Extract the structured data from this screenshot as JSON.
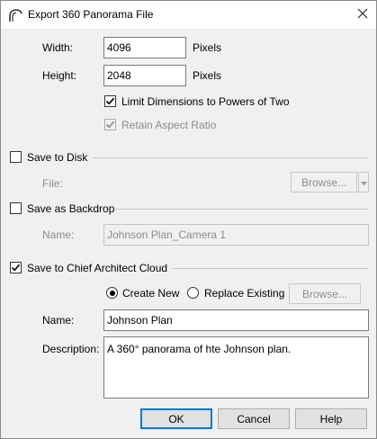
{
  "window": {
    "title": "Export 360 Panorama File"
  },
  "size": {
    "width_label": "Width:",
    "width_value": "4096",
    "width_unit": "Pixels",
    "height_label": "Height:",
    "height_value": "2048",
    "height_unit": "Pixels",
    "limit_powers_label": "Limit Dimensions to Powers of Two",
    "limit_powers_checked": true,
    "retain_aspect_label": "Retain Aspect Ratio",
    "retain_aspect_checked": true
  },
  "save_to_disk": {
    "label": "Save to Disk",
    "checked": false,
    "file_label": "File:",
    "browse_label": "Browse..."
  },
  "save_as_backdrop": {
    "label": "Save as Backdrop",
    "checked": false,
    "name_label": "Name:",
    "name_value": "Johnson Plan_Camera 1"
  },
  "save_to_cloud": {
    "label": "Save to Chief Architect Cloud",
    "checked": true,
    "create_new_label": "Create New",
    "create_new_selected": true,
    "replace_existing_label": "Replace Existing",
    "browse_label": "Browse...",
    "name_label": "Name:",
    "name_value": "Johnson Plan",
    "description_label": "Description:",
    "description_value": "A 360° panorama of hte Johnson plan."
  },
  "buttons": {
    "ok": "OK",
    "cancel": "Cancel",
    "help": "Help"
  }
}
